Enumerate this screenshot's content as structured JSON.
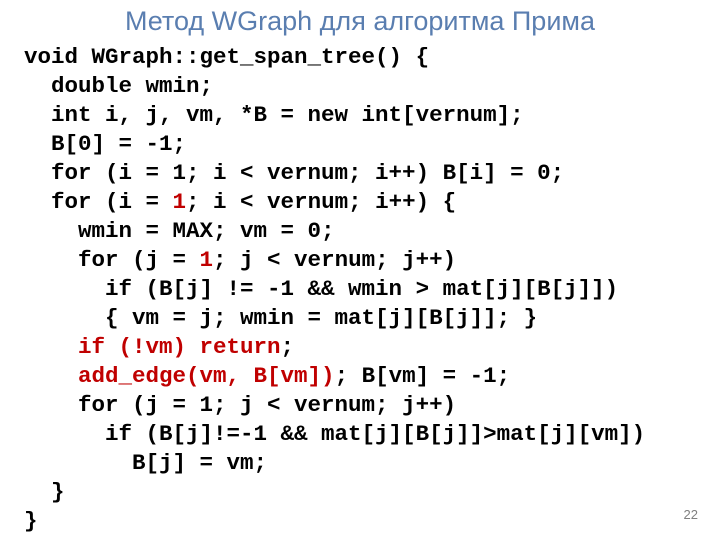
{
  "title": "Метод WGraph для алгоритма Прима",
  "page_number": "22",
  "code": {
    "l0": "void WGraph::get_span_tree() {",
    "l1": "  double wmin;",
    "l2": "  int i, j, vm, *B = new int[vernum];",
    "l3": "  B[0] = -1;",
    "l4": "  for (i = 1; i < vernum; i++) B[i] = 0;",
    "l5a": "  for (i = ",
    "l5r": "1",
    "l5b": "; i < vernum; i++) {",
    "l6": "    wmin = MAX; vm = 0;",
    "l7a": "    for (j = ",
    "l7r": "1",
    "l7b": "; j < vernum; j++)",
    "l8": "      if (B[j] != -1 && wmin > mat[j][B[j]])",
    "l9": "      { vm = j; wmin = mat[j][B[j]]; }",
    "l10r": "    if (!vm) return",
    "l10b": ";",
    "l11r": "    add_edge(vm, B[vm])",
    "l11b": "; B[vm] = -1;",
    "l12": "    for (j = 1; j < vernum; j++)",
    "l13": "      if (B[j]!=-1 && mat[j][B[j]]>mat[j][vm])",
    "l14": "        B[j] = vm;",
    "l15": "  }",
    "l16": "}"
  }
}
